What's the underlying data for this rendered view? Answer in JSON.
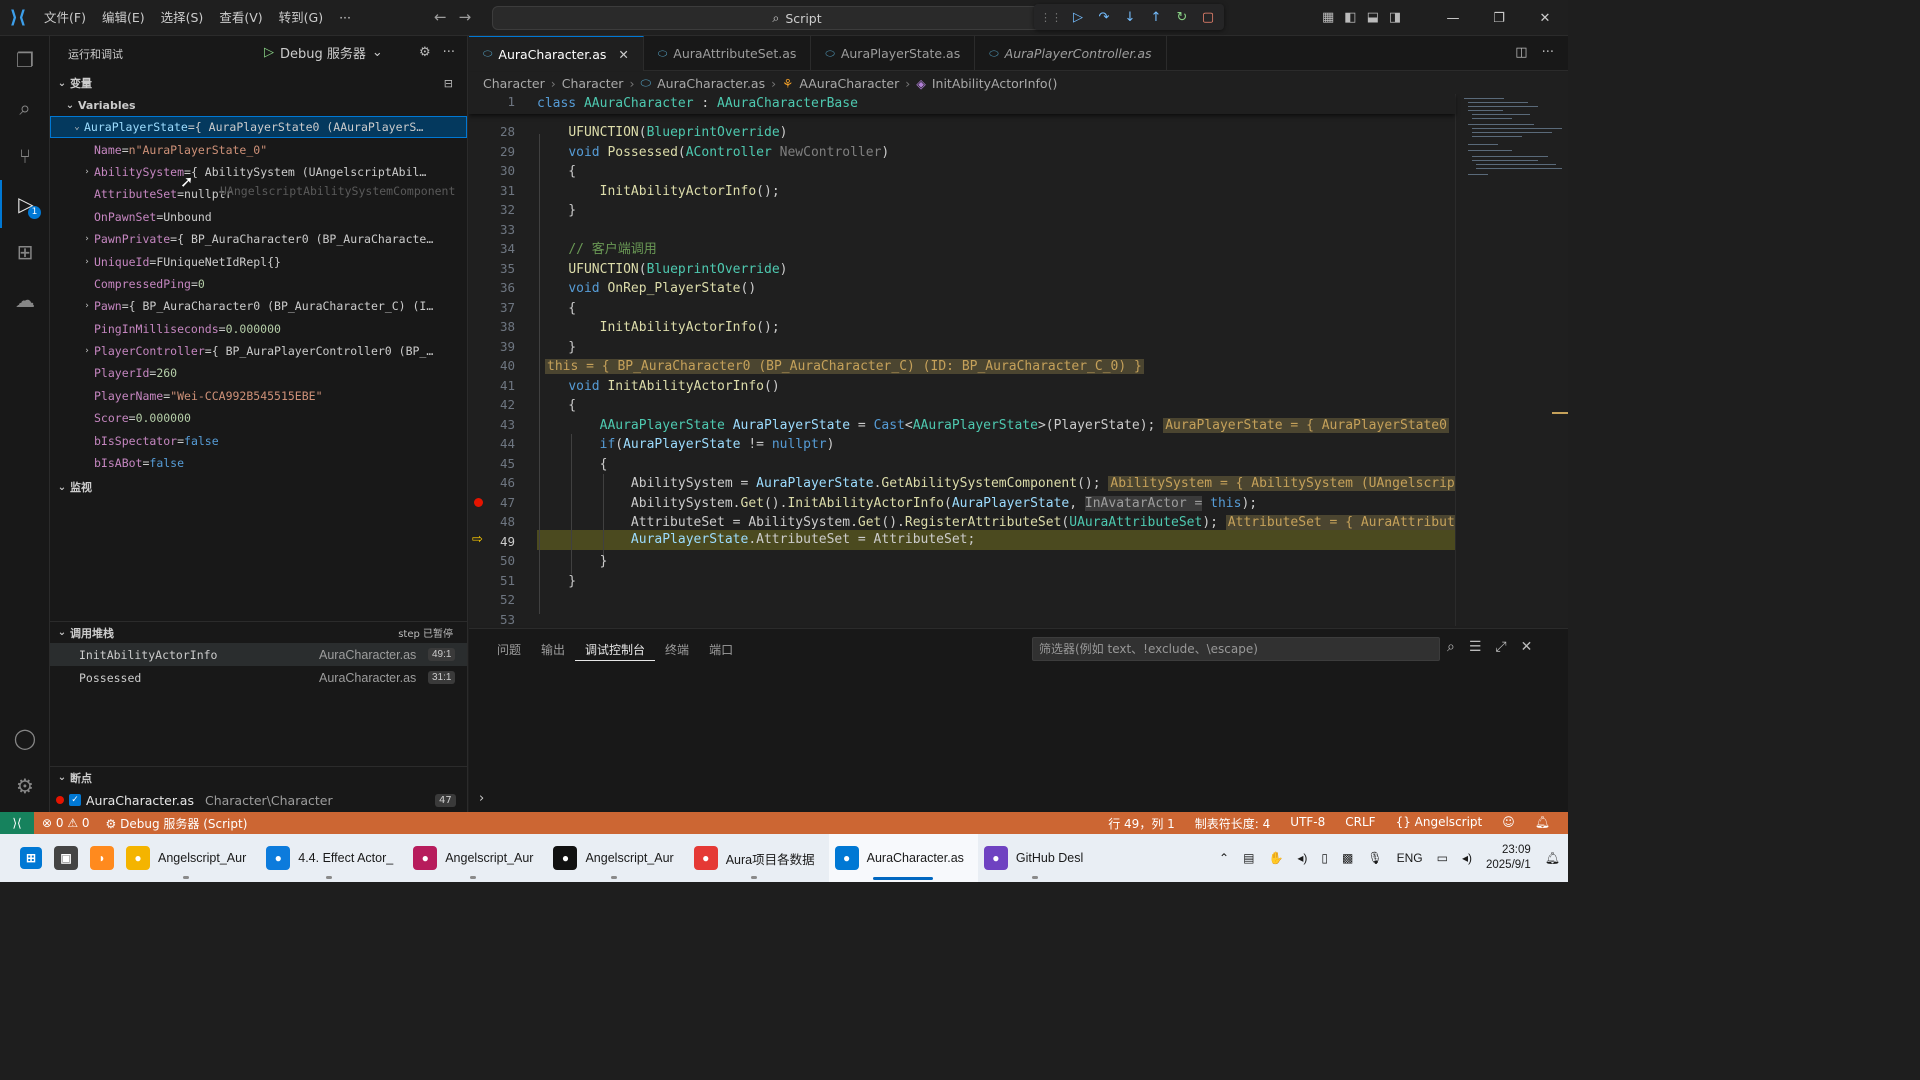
{
  "titlebar": {
    "menu": [
      "文件(F)",
      "编辑(E)",
      "选择(S)",
      "查看(V)",
      "转到(G)",
      "···"
    ],
    "search": "Script"
  },
  "sidebar": {
    "title": "运行和调试",
    "debug_config": "Debug 服务器",
    "variables_section": "变量",
    "variables_group": "Variables",
    "variables": [
      {
        "name": "AuraPlayerState",
        "value": "{ AuraPlayerState0 (AAuraPlayerS…",
        "expanded": true,
        "level": 0,
        "selected": true
      },
      {
        "name": "Name",
        "value": "n\"AuraPlayerState_0\"",
        "level": 1,
        "kind": "str"
      },
      {
        "name": "AbilitySystem",
        "value": "{ AbilitySystem (UAngelscriptAbil…",
        "level": 1,
        "collapsible": true
      },
      {
        "name": "AttributeSet",
        "value": "nullptr",
        "level": 1,
        "kind": "plain"
      },
      {
        "name": "OnPawnSet",
        "value": "Unbound",
        "level": 1,
        "kind": "plain"
      },
      {
        "name": "PawnPrivate",
        "value": "{ BP_AuraCharacter0 (BP_AuraCharacte…",
        "level": 1,
        "collapsible": true
      },
      {
        "name": "UniqueId",
        "value": "FUniqueNetIdRepl{}",
        "level": 1,
        "collapsible": true
      },
      {
        "name": "CompressedPing",
        "value": "0",
        "level": 1,
        "kind": "num"
      },
      {
        "name": "Pawn",
        "value": "{ BP_AuraCharacter0 (BP_AuraCharacter_C) (I…",
        "level": 1,
        "collapsible": true
      },
      {
        "name": "PingInMilliseconds",
        "value": "0.000000",
        "level": 1,
        "kind": "num"
      },
      {
        "name": "PlayerController",
        "value": "{ BP_AuraPlayerController0 (BP_…",
        "level": 1,
        "collapsible": true
      },
      {
        "name": "PlayerId",
        "value": "260",
        "level": 1,
        "kind": "num"
      },
      {
        "name": "PlayerName",
        "value": "\"Wei-CCA992B545515EBE\"",
        "level": 1,
        "kind": "str"
      },
      {
        "name": "Score",
        "value": "0.000000",
        "level": 1,
        "kind": "num"
      },
      {
        "name": "bIsSpectator",
        "value": "false",
        "level": 1,
        "kind": "bool"
      },
      {
        "name": "bIsABot",
        "value": "false",
        "level": 1,
        "kind": "bool"
      }
    ],
    "hover_tooltip": "UAngelscriptAbilitySystemComponent",
    "watch_section": "监视",
    "callstack_section": "调用堆栈",
    "callstack_status": "step 已暂停",
    "callstack": [
      {
        "func": "InitAbilityActorInfo",
        "file": "AuraCharacter.as",
        "pos": "49:1"
      },
      {
        "func": "Possessed",
        "file": "AuraCharacter.as",
        "pos": "31:1"
      }
    ],
    "breakpoints_section": "断点",
    "breakpoint": {
      "file": "AuraCharacter.as",
      "path": "Character\\Character",
      "line": "47"
    }
  },
  "tabs": [
    {
      "label": "AuraCharacter.as",
      "active": true
    },
    {
      "label": "AuraAttributeSet.as"
    },
    {
      "label": "AuraPlayerState.as"
    },
    {
      "label": "AuraPlayerController.as",
      "italic": true
    }
  ],
  "breadcrumb": [
    "Character",
    "Character",
    "AuraCharacter.as",
    "AAuraCharacter",
    "InitAbilityActorInfo()"
  ],
  "editor": {
    "current_line": 49,
    "breakpoint_line": 47
  },
  "panel": {
    "tabs": [
      "问题",
      "输出",
      "调试控制台",
      "终端",
      "端口"
    ],
    "active_tab": "调试控制台",
    "filter_placeholder": "筛选器(例如 text、!exclude、\\escape)"
  },
  "statusbar": {
    "problems": "⊗ 0 ⚠ 0",
    "debug": "Debug 服务器 (Script)",
    "position": "行 49，列 1",
    "tabsize": "制表符长度: 4",
    "encoding": "UTF-8",
    "eol": "CRLF",
    "language": "{} Angelscript"
  },
  "taskbar": {
    "apps": [
      {
        "label": "Angelscript_Aur",
        "color": "#f4b400",
        "icon": "folder-icon"
      },
      {
        "label": "4.4. Effect Actor_",
        "color": "#0c7bdc",
        "icon": "edge-icon"
      },
      {
        "label": "Angelscript_Aur",
        "color": "#b71c5c",
        "icon": "rider-icon"
      },
      {
        "label": "Angelscript_Aur",
        "color": "#111111",
        "icon": "unreal-icon"
      },
      {
        "label": "Aura项目各数据",
        "color": "#e53935",
        "icon": "xmind-icon"
      },
      {
        "label": "AuraCharacter.as",
        "color": "#0078d4",
        "icon": "vscode-icon",
        "active": true
      },
      {
        "label": "GitHub Desl",
        "color": "#6f42c1",
        "icon": "github-desktop-icon"
      }
    ],
    "lang": "ENG",
    "time": "23:09",
    "date": "2025/9/1"
  }
}
